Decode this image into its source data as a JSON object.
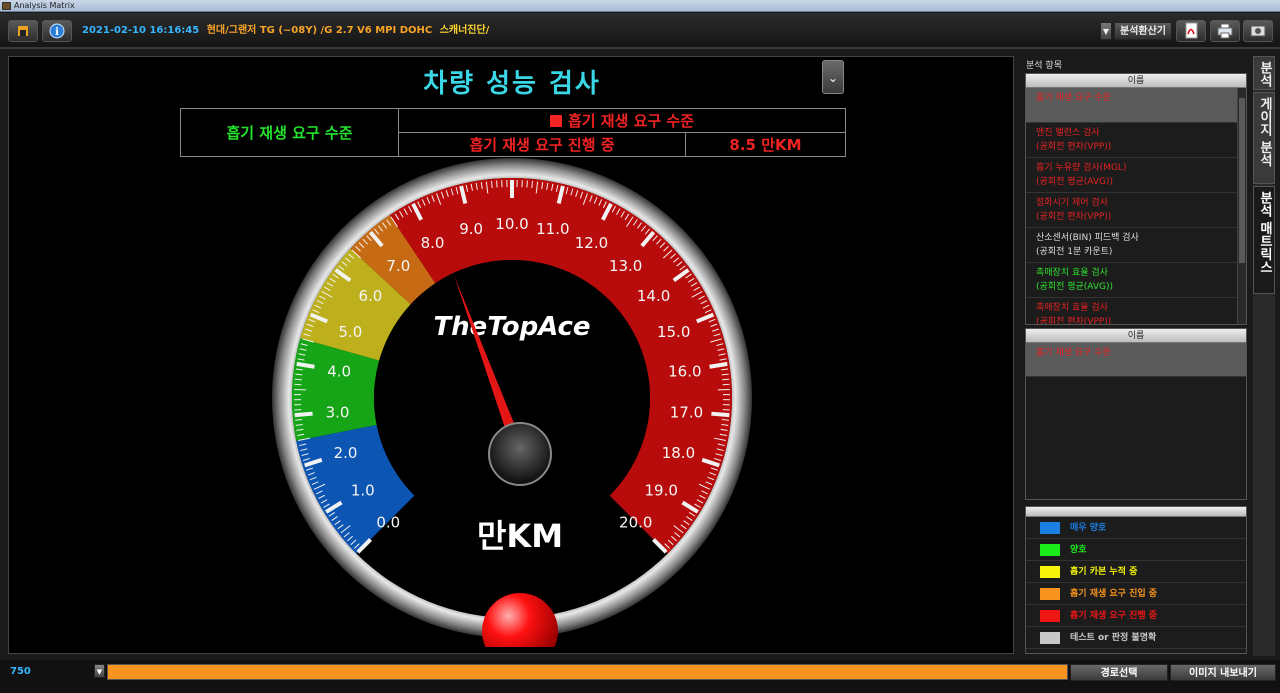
{
  "window": {
    "title": "Analysis Matrix"
  },
  "toolbar": {
    "datetime": "2021-02-10 16:16:45",
    "vehicle": "현대/그랜저 TG (~08Y) /G 2.7 V6 MPI DOHC",
    "mode": "스캐너진단/",
    "env_button": "분석환산기"
  },
  "gauge": {
    "title": "차량 성능 검사",
    "brand": "TheTopAce",
    "unit": "만KM",
    "status_label": "흡기 재생 요구 수준",
    "status_header": "흡기 재생 요구 수준",
    "status_progress": "흡기 재생 요구 진행 중",
    "status_value": "8.5 만KM",
    "value": 8.5,
    "min": 0,
    "max": 20,
    "ticks": [
      "0.0",
      "1.0",
      "2.0",
      "3.0",
      "4.0",
      "5.0",
      "6.0",
      "7.0",
      "8.0",
      "9.0",
      "10.0",
      "11.0",
      "12.0",
      "13.0",
      "14.0",
      "15.0",
      "16.0",
      "17.0",
      "18.0",
      "19.0",
      "20.0"
    ],
    "zones": [
      {
        "from": 0,
        "to": 2.5,
        "color": "#0d55b3"
      },
      {
        "from": 2.5,
        "to": 4.5,
        "color": "#16a516"
      },
      {
        "from": 4.5,
        "to": 6.5,
        "color": "#bdb01c"
      },
      {
        "from": 6.5,
        "to": 7.5,
        "color": "#c76a14"
      },
      {
        "from": 7.5,
        "to": 20,
        "color": "#b80b0b"
      }
    ]
  },
  "right_panel": {
    "section_label": "분석 항목",
    "column_header": "이름",
    "items": [
      {
        "line1": "흡기 재생 요구 수준",
        "line2": "",
        "color": "#e52222",
        "selected": true
      },
      {
        "line1": "엔진 밸런스 검사",
        "line2": "(공회전 편차(VPP))",
        "color": "#e52222"
      },
      {
        "line1": "흡기 누유량 검사(MGL)",
        "line2": "(공회전 평균(AVG))",
        "color": "#e52222"
      },
      {
        "line1": "점화시기 제어 검사",
        "line2": "(공회전 편차(VPP))",
        "color": "#e52222"
      },
      {
        "line1": "산소센서(BIN) 피드백 검사",
        "line2": "(공회전 1분 카운트)",
        "color": "#dddddd"
      },
      {
        "line1": "촉매장치 효율 검사",
        "line2": "(공회전 평균(AVG))",
        "color": "#2ee02e"
      },
      {
        "line1": "촉매장치 효율 검사",
        "line2": "(공회전 편차(VPP))",
        "color": "#e52222"
      }
    ],
    "selected_header": "이름",
    "selected_item": "흡기 재생 요구 수준"
  },
  "legend": [
    {
      "label": "매우 양호",
      "color": "#1a7fe0"
    },
    {
      "label": "양호",
      "color": "#1bea1b"
    },
    {
      "label": "흡기 카본 누적 중",
      "color": "#f5f50a"
    },
    {
      "label": "흡기 재생 요구 진입 중",
      "color": "#f7941d"
    },
    {
      "label": "흡기 재생 요구 진행 중",
      "color": "#f01616"
    },
    {
      "label": "테스트 or 판정 불명확",
      "color": "#c8c8c8"
    }
  ],
  "side_tabs": [
    "분석",
    "게이지 분석",
    "분석 매트릭스"
  ],
  "bottom": {
    "count": "750",
    "progress": 1.0,
    "route_button": "경로선택",
    "export_button": "이미지 내보내기"
  }
}
